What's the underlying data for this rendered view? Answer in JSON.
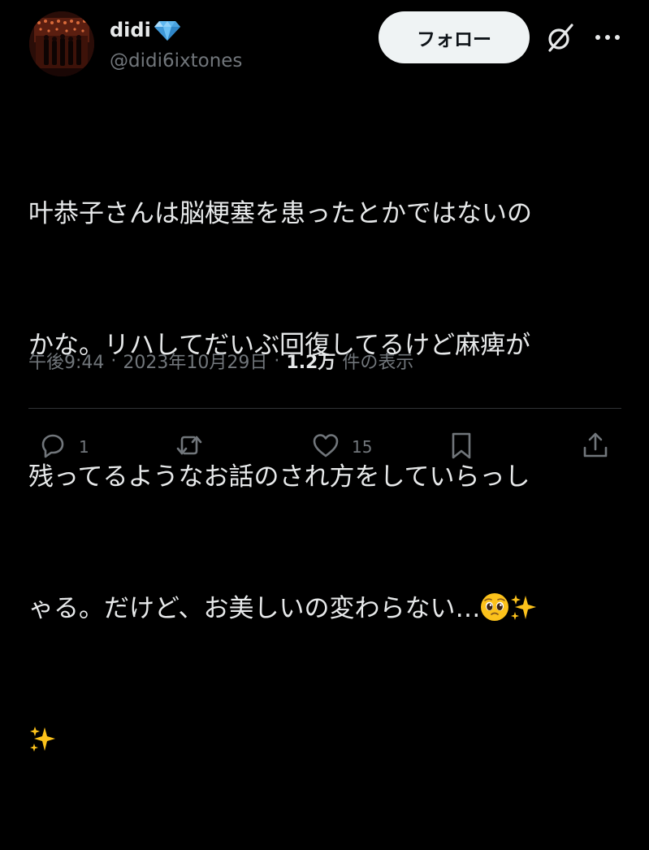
{
  "user": {
    "display_name": "didi",
    "badge_icon": "gem-icon",
    "handle": "@didi6ixtones"
  },
  "header": {
    "follow_label": "フォロー",
    "grok_icon": "grok-icon",
    "more_icon": "more-icon"
  },
  "tweet": {
    "lines": [
      "叶恭子さんは脳梗塞を患ったとかではないの",
      "かな。リハしてだいぶ回復してるけど麻痺が",
      "残ってるようなお話のされ方をしていらっし",
      "ゃる。だけど、お美しいの変わらない…"
    ],
    "emojis": [
      "pleading-face-emoji",
      "sparkles-emoji",
      "sparkles-emoji"
    ]
  },
  "meta": {
    "time": "午後9:44",
    "separator": "·",
    "date": "2023年10月29日",
    "views_count": "1.2万",
    "views_label": "件の表示"
  },
  "actions": {
    "reply_count": "1",
    "retweet_count": "",
    "like_count": "15",
    "bookmark_count": "",
    "share_count": ""
  },
  "colors": {
    "background": "#000000",
    "text_primary": "#e7e9ea",
    "text_secondary": "#71767b",
    "divider": "#2f3336",
    "button_bg": "#eff3f4",
    "button_text": "#0f1419",
    "badge": "#5fb7f0",
    "emoji_yellow": "#fcc21b"
  }
}
